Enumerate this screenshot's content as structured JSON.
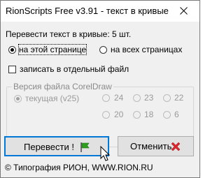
{
  "window": {
    "title": "RionScripts Free v3.91 - текст в кривые"
  },
  "summary": {
    "label": "Перевести текст в кривые: 5 шт."
  },
  "scope": {
    "options": [
      {
        "label": "на этой странице",
        "checked": true
      },
      {
        "label": "на всех страницах",
        "checked": false
      }
    ]
  },
  "separate_file": {
    "label": "записать в отдельный файл",
    "checked": false
  },
  "version_group": {
    "title": "Версия файла CorelDraw",
    "current": {
      "label": "текущая (v25)",
      "checked": true
    },
    "versions": [
      "24",
      "23",
      "22",
      "20",
      "18",
      "6"
    ]
  },
  "buttons": {
    "convert": "Перевести !",
    "cancel": "Отменить"
  },
  "footer": {
    "text": "© Типография РИОН,  WWW.RION.RU"
  },
  "colors": {
    "flag_green": "#2e9e1f",
    "cancel_red": "#d9262c",
    "focus_blue": "#0078d7"
  }
}
